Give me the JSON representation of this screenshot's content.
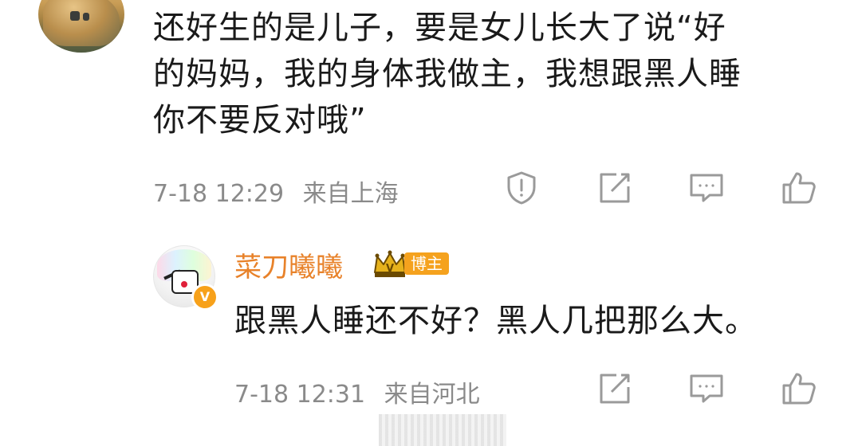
{
  "comment": {
    "lines": [
      "还好生的是儿子，要是女儿长大了说“好",
      "的妈妈，我的身体我做主，我想跟黑人睡",
      "你不要反对哦”"
    ],
    "time": "7-18 12:29",
    "location": "来自上海"
  },
  "reply": {
    "username": "菜刀曦曦",
    "vip_badge": "V",
    "role_tag": "博主",
    "verified_badge": "V",
    "text": "跟黑人睡还不好？黑人几把那么大。",
    "time": "7-18 12:31",
    "location": "来自河北"
  },
  "icons": {
    "report": "report-icon",
    "repost": "repost-icon",
    "reply": "comment-icon",
    "like": "like-icon"
  },
  "colors": {
    "username": "#e8822a",
    "tag": "#f5a21e",
    "meta": "#8a8a8a",
    "icon": "#9a9a9a"
  }
}
